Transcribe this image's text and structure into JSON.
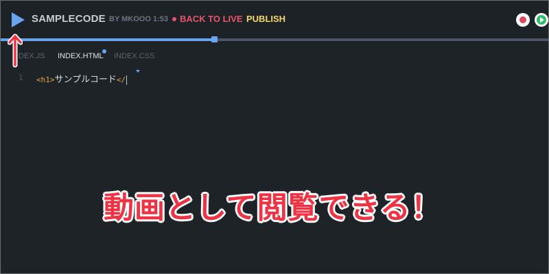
{
  "header": {
    "title": "SAMPLECODE",
    "byline": "BY MKOOO 1:53",
    "back_to_live": "BACK TO LIVE",
    "publish": "PUBLISH",
    "play_icon": "play-icon",
    "record_icon": "record-icon",
    "go_live_icon": "play-circle-icon"
  },
  "progress": {
    "played_fraction": 0.39
  },
  "tabs": [
    {
      "label": "INDEX.JS",
      "visible_text": "DEX.JS",
      "active": false
    },
    {
      "label": "INDEX.HTML",
      "active": true,
      "modified": true
    },
    {
      "label": "INDEX.CSS",
      "active": false
    }
  ],
  "editor": {
    "line_number": "1",
    "open_tag": "<h1>",
    "text": "サンプルコード",
    "close_tag": "</"
  },
  "annotation": {
    "text": "動画として閲覧できる！"
  },
  "colors": {
    "background": "#1e2328",
    "accent_blue": "#6aa3f0",
    "live_red": "#e8556a",
    "publish_yellow": "#f3d86a",
    "tag_orange": "#e4a74a",
    "annotation_red": "#ee3344"
  }
}
